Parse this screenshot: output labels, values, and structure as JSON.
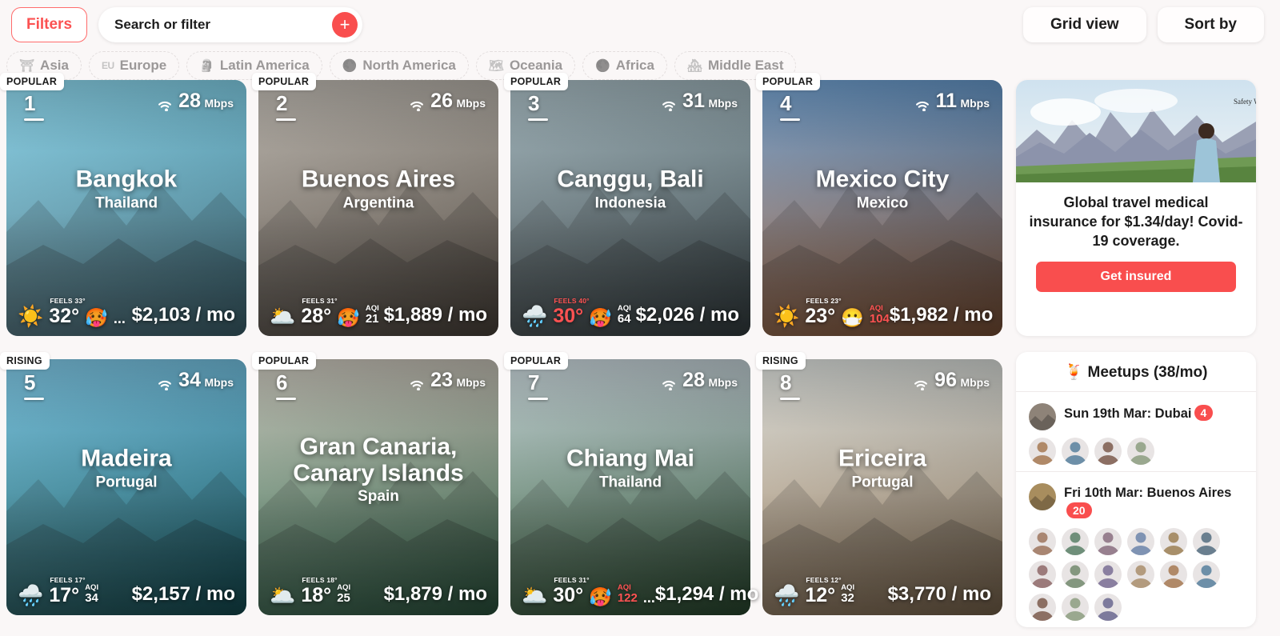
{
  "header": {
    "filters_label": "Filters",
    "search_placeholder": "Search or filter",
    "search_value": "",
    "add_icon": "+",
    "grid_view_label": "Grid view",
    "sort_by_label": "Sort by"
  },
  "regions": [
    {
      "label": "Asia",
      "glyph": "⛩"
    },
    {
      "label": "Europe",
      "glyph": "EU"
    },
    {
      "label": "Latin America",
      "glyph": "🗿"
    },
    {
      "label": "North America",
      "glyph": "🌑"
    },
    {
      "label": "Oceania",
      "glyph": "🗺"
    },
    {
      "label": "Africa",
      "glyph": "🌑"
    },
    {
      "label": "Middle East",
      "glyph": "🏘"
    }
  ],
  "cities": [
    {
      "tag": "POPULAR",
      "rank": "1",
      "speed": "28",
      "speed_unit": "Mbps",
      "city": "Bangkok",
      "country": "Thailand",
      "weather_icon": "☀️",
      "feels": "FEELS 33°",
      "temp": "32°",
      "face": "🥵",
      "aqi_label": "",
      "aqi_value": "",
      "aqi_bad": false,
      "dots": "...",
      "price": "$2,103 / mo",
      "hot": false,
      "sky_top": "#6fc6e0",
      "sky_bottom": "#5a8fa0"
    },
    {
      "tag": "POPULAR",
      "rank": "2",
      "speed": "26",
      "speed_unit": "Mbps",
      "city": "Buenos Aires",
      "country": "Argentina",
      "weather_icon": "🌥️",
      "feels": "FEELS 31°",
      "temp": "28°",
      "face": "🥵",
      "aqi_label": "AQI",
      "aqi_value": "21",
      "aqi_bad": false,
      "dots": "",
      "price": "$1,889 / mo",
      "hot": false,
      "sky_top": "#a9a39a",
      "sky_bottom": "#6d6257"
    },
    {
      "tag": "POPULAR",
      "rank": "3",
      "speed": "31",
      "speed_unit": "Mbps",
      "city": "Canggu, Bali",
      "country": "Indonesia",
      "weather_icon": "🌧️",
      "feels": "FEELS 40°",
      "temp": "30°",
      "face": "🥵",
      "aqi_label": "AQI",
      "aqi_value": "64",
      "aqi_bad": false,
      "dots": "",
      "price": "$2,026 / mo",
      "hot": true,
      "sky_top": "#8fa6ae",
      "sky_bottom": "#4c5a5e"
    },
    {
      "tag": "POPULAR",
      "rank": "4",
      "speed": "11",
      "speed_unit": "Mbps",
      "city": "Mexico City",
      "country": "Mexico",
      "weather_icon": "☀️",
      "feels": "FEELS 23°",
      "temp": "23°",
      "face": "😷",
      "aqi_label": "AQI",
      "aqi_value": "104",
      "aqi_bad": true,
      "dots": "",
      "price": "$1,982 / mo",
      "hot": false,
      "sky_top": "#4f86bd",
      "sky_bottom": "#b6764e"
    },
    {
      "tag": "RISING",
      "rank": "5",
      "speed": "34",
      "speed_unit": "Mbps",
      "city": "Madeira",
      "country": "Portugal",
      "weather_icon": "🌧️",
      "feels": "FEELS 17°",
      "temp": "17°",
      "face": "",
      "aqi_label": "AQI",
      "aqi_value": "34",
      "aqi_bad": false,
      "dots": "",
      "price": "$2,157 / mo",
      "hot": false,
      "sky_top": "#5fb5d8",
      "sky_bottom": "#1d6f78"
    },
    {
      "tag": "POPULAR",
      "rank": "6",
      "speed": "23",
      "speed_unit": "Mbps",
      "city": "Gran Canaria, Canary Islands",
      "country": "Spain",
      "weather_icon": "🌥️",
      "feels": "FEELS 18°",
      "temp": "18°",
      "face": "",
      "aqi_label": "AQI",
      "aqi_value": "25",
      "aqi_bad": false,
      "dots": "",
      "price": "$1,879 / mo",
      "hot": false,
      "sky_top": "#b7b2a6",
      "sky_bottom": "#3f7d5c"
    },
    {
      "tag": "POPULAR",
      "rank": "7",
      "speed": "28",
      "speed_unit": "Mbps",
      "city": "Chiang Mai",
      "country": "Thailand",
      "weather_icon": "🌥️",
      "feels": "FEELS 31°",
      "temp": "30°",
      "face": "🥵",
      "aqi_label": "AQI",
      "aqi_value": "122",
      "aqi_bad": true,
      "dots": "...",
      "price": "$1,294 / mo",
      "hot": false,
      "sky_top": "#b7c6cc",
      "sky_bottom": "#3c6b45"
    },
    {
      "tag": "RISING",
      "rank": "8",
      "speed": "96",
      "speed_unit": "Mbps",
      "city": "Ericeira",
      "country": "Portugal",
      "weather_icon": "🌧️",
      "feels": "FEELS 12°",
      "temp": "12°",
      "face": "",
      "aqi_label": "AQI",
      "aqi_value": "32",
      "aqi_bad": false,
      "dots": "",
      "price": "$3,770 / mo",
      "hot": false,
      "sky_top": "#cfd3cf",
      "sky_bottom": "#b39470"
    }
  ],
  "ad": {
    "text": "Global travel medical insurance for $1.34/day! Covid-19 coverage.",
    "button_label": "Get insured",
    "watermark": "Safety W"
  },
  "meetups": {
    "title": "🍹 Meetups (38/mo)",
    "items": [
      {
        "label": "Sun 19th Mar: Dubai",
        "count": "4",
        "avatars": 4
      },
      {
        "label": "Fri 10th Mar: Buenos Aires",
        "count": "20",
        "avatars": 15
      }
    ]
  },
  "colors": {
    "accent": "#f94e4e",
    "background": "#faf7f7",
    "bad_aqi": "#ff5252"
  }
}
